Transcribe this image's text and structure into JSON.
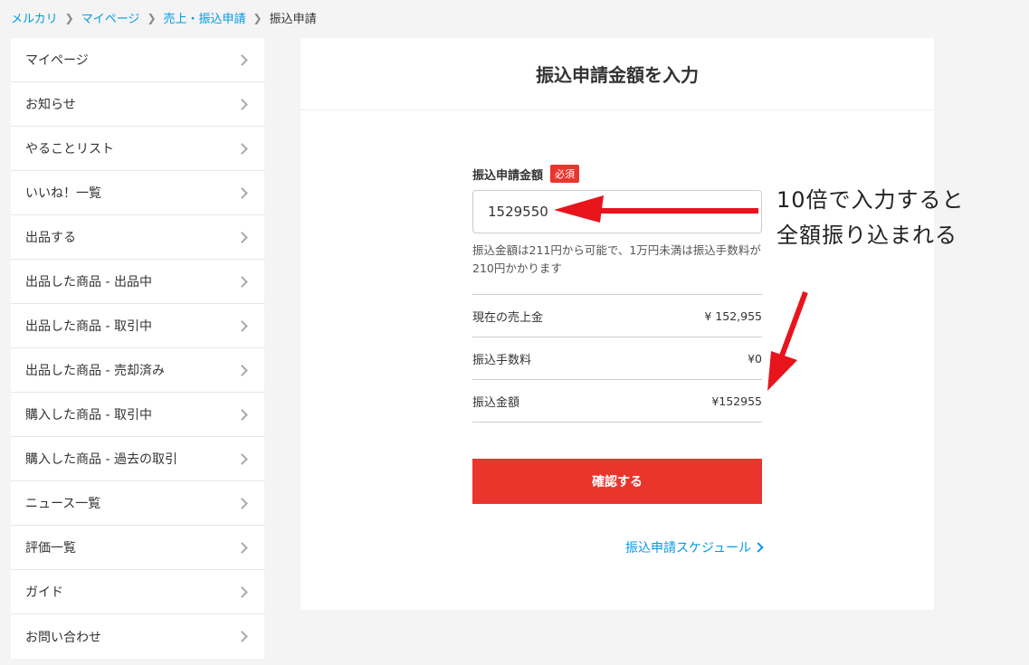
{
  "breadcrumb": {
    "items": [
      "メルカリ",
      "マイページ",
      "売上・振込申請"
    ],
    "current": "振込申請"
  },
  "sidebar": {
    "items": [
      {
        "label": "マイページ"
      },
      {
        "label": "お知らせ"
      },
      {
        "label": "やることリスト"
      },
      {
        "label": "いいね！一覧"
      },
      {
        "label": "出品する"
      },
      {
        "label": "出品した商品 - 出品中"
      },
      {
        "label": "出品した商品 - 取引中"
      },
      {
        "label": "出品した商品 - 売却済み"
      },
      {
        "label": "購入した商品 - 取引中"
      },
      {
        "label": "購入した商品 - 過去の取引"
      },
      {
        "label": "ニュース一覧"
      },
      {
        "label": "評価一覧"
      },
      {
        "label": "ガイド"
      },
      {
        "label": "お問い合わせ"
      }
    ]
  },
  "main": {
    "title": "振込申請金額を入力",
    "field_label": "振込申請金額",
    "required_badge": "必須",
    "amount_value": "1529550",
    "note": "振込金額は211円から可能で、1万円未満は振込手数料が210円かかります",
    "summary": [
      {
        "label": "現在の売上金",
        "value": "¥ 152,955"
      },
      {
        "label": "振込手数料",
        "value": "¥0"
      },
      {
        "label": "振込金額",
        "value": "¥152955"
      }
    ],
    "confirm_label": "確認する",
    "schedule_link": "振込申請スケジュール"
  },
  "annotation": {
    "line1": "10倍で入力すると",
    "line2": "全額振り込まれる"
  },
  "colors": {
    "accent": "#ea352d",
    "link": "#0099e8",
    "arrow": "#e8141c",
    "background": "#f4f4f4"
  }
}
